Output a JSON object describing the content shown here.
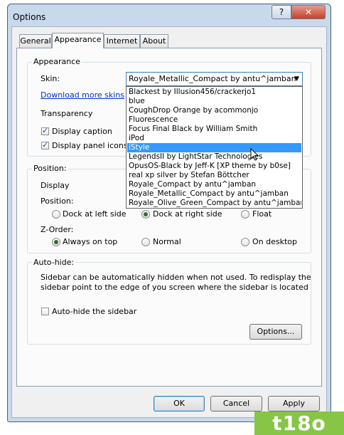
{
  "window": {
    "title": "Options",
    "help_label": "?",
    "close_label": "✕"
  },
  "tabs": [
    "General",
    "Appearance",
    "Internet",
    "About"
  ],
  "appearance": {
    "group_label": "Appearance",
    "skin_label": "Skin:",
    "skin_value": "Royale_Metallic_Compact by antu^jamban",
    "download_link": "Download more skins",
    "transparency_label": "Transparency",
    "display_caption": "Display caption",
    "display_panel_icons": "Display panel icons",
    "skin_options": [
      "Blackest by Illusion456/crackerjo1",
      "blue",
      "CoughDrop Orange by acommonjo",
      "Fluorescence",
      "Focus Final Black by William Smith",
      "iPod",
      "iStyle",
      "LegendsII by LightStar Technologies",
      "OpusOS-Black by Jeff-K [XP theme by b0se]",
      "real xp silver by Stefan Böttcher",
      "Royale_Compact by antu^jamban",
      "Royale_Metallic_Compact by antu^jamban",
      "Royale_Olive_Green_Compact by antu^jamban"
    ],
    "selected_option": "iStyle"
  },
  "position": {
    "group_label": "Position:",
    "display_label": "Display",
    "position_label": "Position:",
    "dock_left": "Dock at left side",
    "dock_right": "Dock at right side",
    "float": "Float",
    "zorder_label": "Z-Order:",
    "always_on_top": "Always on top",
    "normal": "Normal",
    "on_desktop": "On desktop"
  },
  "autohide": {
    "group_label": "Auto-hide:",
    "description_line1": "Sidebar can be automatically hidden when not used. To redisplay the",
    "description_line2": "sidebar point to the edge of you screen where the sidebar is located",
    "checkbox_label": "Auto-hide the sidebar",
    "options_button": "Options..."
  },
  "footer": {
    "ok": "OK",
    "cancel": "Cancel",
    "apply": "Apply"
  },
  "watermark": "t18o",
  "colors": {
    "selection": "#3399ff",
    "link": "#0033cc",
    "logo": "#86c545"
  }
}
